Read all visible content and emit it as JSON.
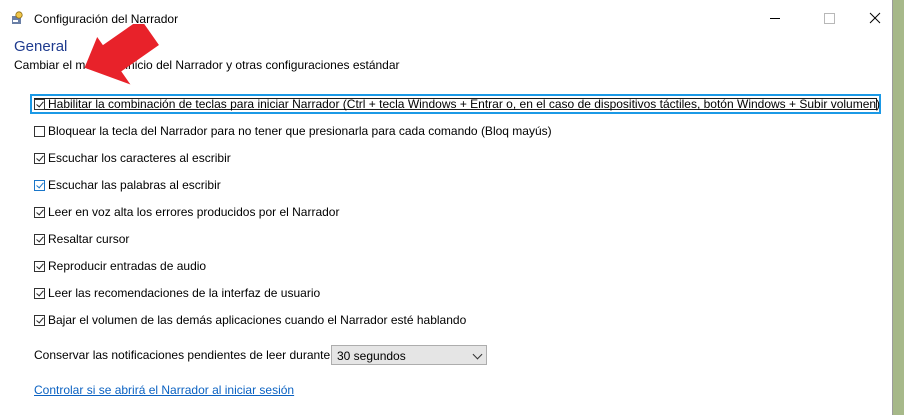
{
  "window": {
    "title": "Configuración del Narrador",
    "minimize_label": "Minimizar",
    "maximize_label": "Maximizar",
    "close_label": "Cerrar"
  },
  "header": {
    "title": "General",
    "subtitle": "Cambiar el modo de inicio del Narrador y otras configuraciones estándar"
  },
  "options": [
    {
      "label": "Habilitar la combinación de teclas para iniciar Narrador (Ctrl + tecla Windows + Entrar o, en el caso de dispositivos táctiles, botón Windows + Subir volumen)",
      "checked": true
    },
    {
      "label": "Bloquear la tecla del Narrador para no tener que presionarla para cada comando (Bloq mayús)",
      "checked": false
    },
    {
      "label": "Escuchar los caracteres al escribir",
      "checked": true
    },
    {
      "label": "Escuchar las palabras al escribir",
      "checked": true
    },
    {
      "label": "Leer en voz alta los errores producidos por el Narrador",
      "checked": true
    },
    {
      "label": "Resaltar cursor",
      "checked": true
    },
    {
      "label": "Reproducir entradas de audio",
      "checked": true
    },
    {
      "label": "Leer las recomendaciones de la interfaz de usuario",
      "checked": true
    },
    {
      "label": "Bajar el volumen de las demás aplicaciones cuando el Narrador esté hablando",
      "checked": true
    }
  ],
  "notifications": {
    "label": "Conservar las notificaciones pendientes de leer durante:",
    "selected": "30 segundos"
  },
  "startup_link": "Controlar si se abrirá el Narrador al iniciar sesión",
  "colors": {
    "heading": "#1f3b8f",
    "focus": "#1b99e6",
    "link": "#0b62c2",
    "annotation_arrow": "#e8222a"
  }
}
